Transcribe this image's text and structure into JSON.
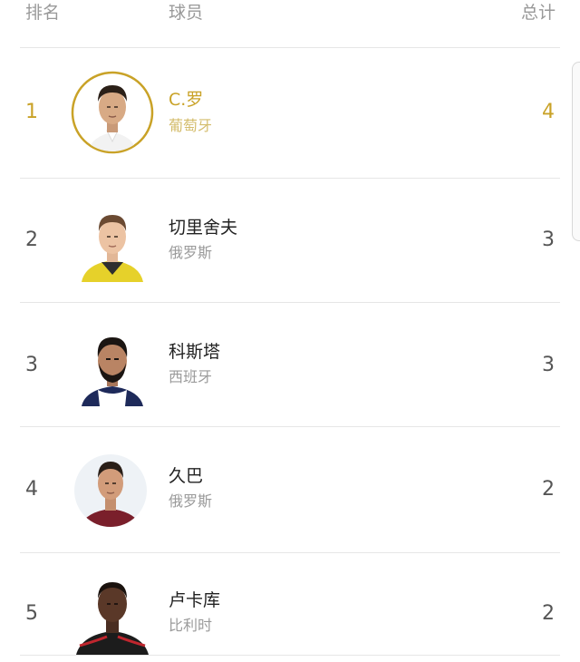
{
  "header": {
    "rank_label": "排名",
    "player_label": "球员",
    "total_label": "总计"
  },
  "colors": {
    "accent_gold": "#c9a227"
  },
  "players": [
    {
      "rank": "1",
      "name": "C.罗",
      "country": "葡萄牙",
      "total": "4",
      "highlight": true,
      "avatar": "player-photo"
    },
    {
      "rank": "2",
      "name": "切里舍夫",
      "country": "俄罗斯",
      "total": "3",
      "highlight": false,
      "avatar": "player-photo"
    },
    {
      "rank": "3",
      "name": "科斯塔",
      "country": "西班牙",
      "total": "3",
      "highlight": false,
      "avatar": "player-photo"
    },
    {
      "rank": "4",
      "name": "久巴",
      "country": "俄罗斯",
      "total": "2",
      "highlight": false,
      "avatar": "player-photo"
    },
    {
      "rank": "5",
      "name": "卢卡库",
      "country": "比利时",
      "total": "2",
      "highlight": false,
      "avatar": "player-photo"
    }
  ]
}
